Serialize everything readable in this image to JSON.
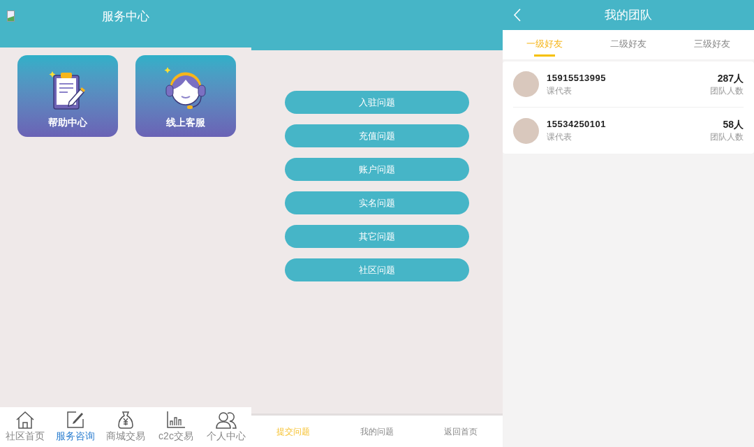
{
  "service_center": {
    "title": "服务中心",
    "cards": [
      {
        "label": "帮助中心",
        "kind": "clipboard"
      },
      {
        "label": "线上客服",
        "kind": "headset"
      }
    ],
    "bottom_nav": [
      {
        "label": "社区首页",
        "kind": "house",
        "selected": false
      },
      {
        "label": "服务咨询",
        "kind": "edit",
        "selected": true
      },
      {
        "label": "商城交易",
        "kind": "moneybag",
        "selected": false
      },
      {
        "label": "c2c交易",
        "kind": "bars",
        "selected": false
      },
      {
        "label": "个人中心",
        "kind": "people",
        "selected": false
      }
    ]
  },
  "questions": {
    "buttons": [
      "入驻问题",
      "充值问题",
      "账户问题",
      "实名问题",
      "其它问题",
      "社区问题"
    ],
    "bottom_tabs": [
      {
        "label": "提交问题",
        "selected": true
      },
      {
        "label": "我的问题",
        "selected": false
      },
      {
        "label": "返回首页",
        "selected": false
      }
    ]
  },
  "team": {
    "title": "我的团队",
    "tabs": [
      {
        "label": "一级好友",
        "selected": true
      },
      {
        "label": "二级好友",
        "selected": false
      },
      {
        "label": "三级好友",
        "selected": false
      }
    ],
    "members": [
      {
        "phone": "15915513995",
        "role": "课代表",
        "count": "287人",
        "count_label": "团队人数"
      },
      {
        "phone": "15534250101",
        "role": "课代表",
        "count": "58人",
        "count_label": "团队人数"
      }
    ]
  }
}
